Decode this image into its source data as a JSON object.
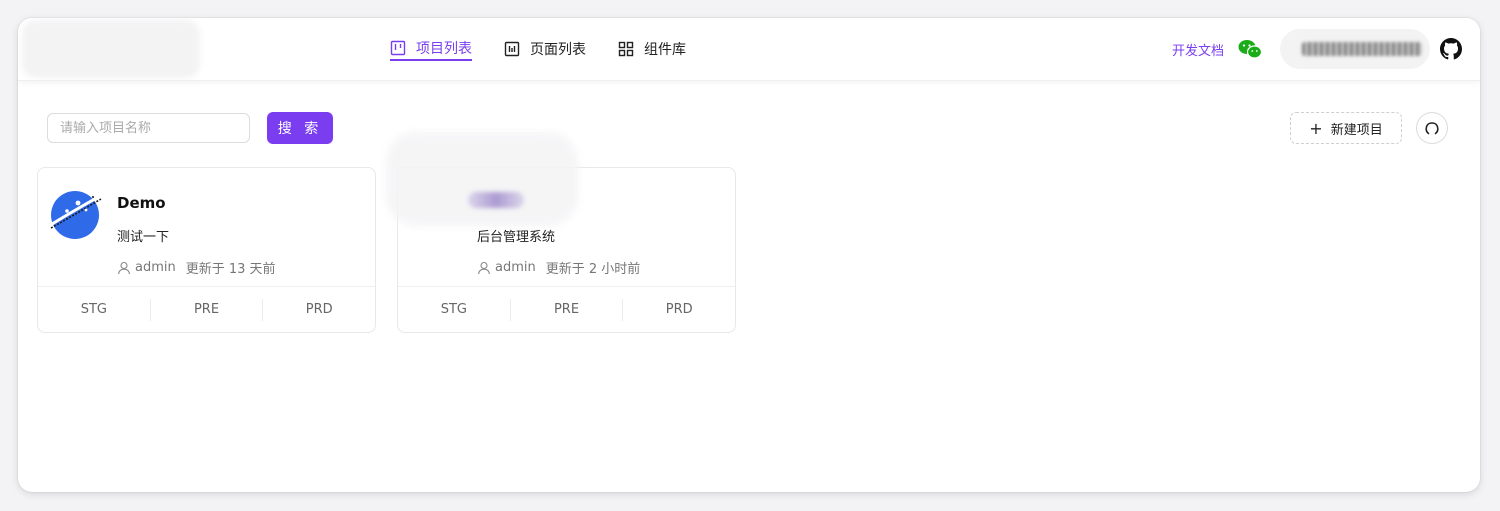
{
  "nav": {
    "items": [
      {
        "label": "项目列表",
        "icon": "kanban-icon",
        "active": true
      },
      {
        "label": "页面列表",
        "icon": "page-icon",
        "active": false
      },
      {
        "label": "组件库",
        "icon": "grid-icon",
        "active": false
      }
    ]
  },
  "header": {
    "docs_label": "开发文档",
    "wechat_icon": "wechat-icon",
    "github_icon": "github-icon"
  },
  "search": {
    "placeholder": "请输入项目名称",
    "value": "",
    "button_label": "搜 索"
  },
  "actions": {
    "new_project_label": "新建项目",
    "plus_icon": "+"
  },
  "projects": [
    {
      "name": "Demo",
      "description": "测试一下",
      "owner": "admin",
      "updated": "更新于 13 天前",
      "envs": [
        "STG",
        "PRE",
        "PRD"
      ]
    },
    {
      "name": "",
      "description": "后台管理系统",
      "owner": "admin",
      "updated": "更新于 2 小时前",
      "envs": [
        "STG",
        "PRE",
        "PRD"
      ]
    }
  ],
  "colors": {
    "accent": "#7a3ef0",
    "wechat": "#1aad19",
    "avatar_blue": "#2f6ae8"
  }
}
